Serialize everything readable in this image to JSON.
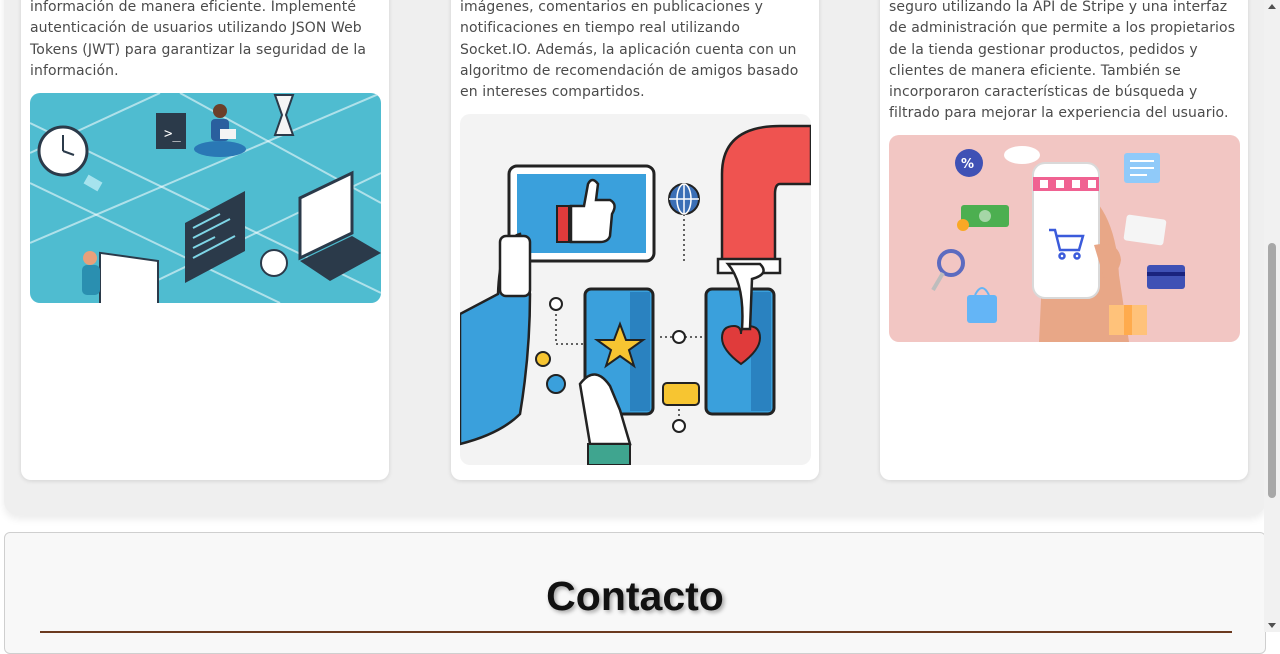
{
  "projects": [
    {
      "description": "información de manera eficiente. Implementé autenticación de usuarios utilizando JSON Web Tokens (JWT) para garantizar la seguridad de la información.",
      "image_alt": "isometric-development-illustration"
    },
    {
      "description": "imágenes, comentarios en publicaciones y notificaciones en tiempo real utilizando Socket.IO. Además, la aplicación cuenta con un algoritmo de recomendación de amigos basado en intereses compartidos.",
      "image_alt": "social-media-illustration"
    },
    {
      "description": "seguro utilizando la API de Stripe y una interfaz de administración que permite a los propietarios de la tienda gestionar productos, pedidos y clientes de manera eficiente. También se incorporaron características de búsqueda y filtrado para mejorar la experiencia del usuario.",
      "image_alt": "online-shopping-illustration"
    }
  ],
  "contact": {
    "title": "Contacto"
  },
  "colors": {
    "section_bg": "#efefef",
    "card_bg": "#ffffff",
    "text": "#4b4b4b",
    "rule": "#6b3a1f"
  }
}
